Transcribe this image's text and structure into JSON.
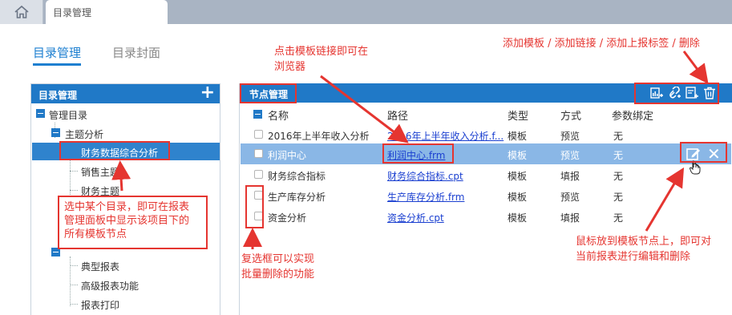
{
  "top_bar": {
    "tab_label": "目录管理"
  },
  "sub_tabs": [
    {
      "label": "目录管理"
    },
    {
      "label": "目录封面"
    }
  ],
  "left_panel": {
    "title": "目录管理",
    "tree": [
      {
        "label": "管理目录"
      },
      {
        "label": "主题分析"
      },
      {
        "label": "财务数据综合分析"
      },
      {
        "label": "销售主题"
      },
      {
        "label": "财务主题"
      },
      {
        "label": "典型报表"
      },
      {
        "label": "高级报表功能"
      },
      {
        "label": "报表打印"
      }
    ]
  },
  "right_panel": {
    "title": "节点管理",
    "toolbar_icons": [
      "add-template-icon",
      "add-link-icon",
      "add-report-tag-icon",
      "delete-icon"
    ],
    "columns": {
      "name": "名称",
      "path": "路径",
      "type": "类型",
      "mode": "方式",
      "param": "参数绑定"
    },
    "rows": [
      {
        "name": "2016年上半年收入分析",
        "path": "2016年上半年收入分析.f...",
        "type": "模板",
        "mode": "预览",
        "param": "无"
      },
      {
        "name": "利润中心",
        "path": "利润中心.frm",
        "type": "模板",
        "mode": "预览",
        "param": "无"
      },
      {
        "name": "财务综合指标",
        "path": "财务综合指标.cpt",
        "type": "模板",
        "mode": "填报",
        "param": "无"
      },
      {
        "name": "生产库存分析",
        "path": "生产库存分析.frm",
        "type": "模板",
        "mode": "预览",
        "param": "无"
      },
      {
        "name": "资金分析",
        "path": "资金分析.cpt",
        "type": "模板",
        "mode": "填报",
        "param": "无"
      }
    ]
  },
  "annotations": {
    "top_right": "添加模板 / 添加链接 / 添加上报标签 / 删除",
    "click_link_line1": "点击模板链接即可在",
    "click_link_line2": "浏览器",
    "callout_line1": "选中某个目录，即可在报表",
    "callout_line2": "管理面板中显示该项目下的",
    "callout_line3": "所有模板节点",
    "checkbox_line1": "复选框可以实现",
    "checkbox_line2": "批量删除的功能",
    "hover_line1": "鼠标放到模板节点上，即可对",
    "hover_line2": "当前报表进行编辑和删除"
  },
  "colors": {
    "accent": "#2079c7",
    "annotation_red": "#e53530",
    "hover_row": "#8ab7e6",
    "link": "#1a3fd0"
  }
}
